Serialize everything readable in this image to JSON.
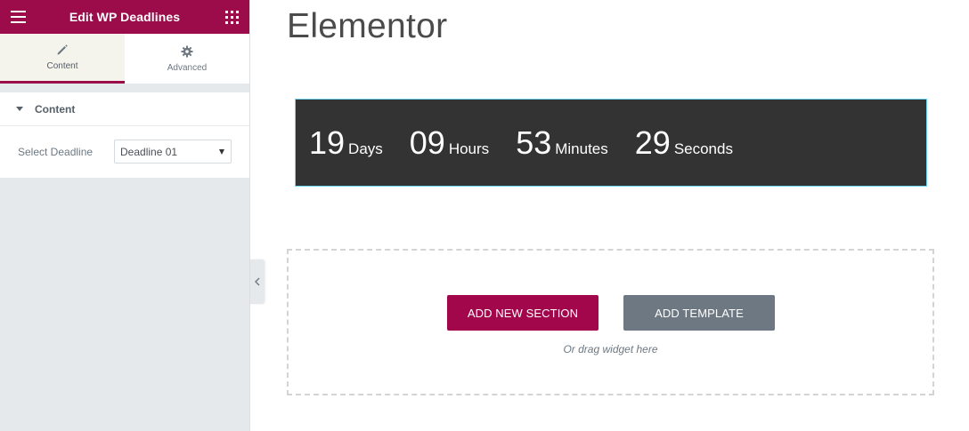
{
  "sidebar": {
    "header_title": "Edit WP Deadlines",
    "menu_icon": "hamburger-menu-icon",
    "widgets_icon": "grid-icon",
    "tabs": [
      {
        "label": "Content",
        "icon": "pencil-icon",
        "active": true
      },
      {
        "label": "Advanced",
        "icon": "gear-icon",
        "active": false
      }
    ],
    "section": {
      "title": "Content",
      "control_label": "Select Deadline",
      "select_value": "Deadline 01"
    }
  },
  "canvas": {
    "page_title": "Elementor",
    "countdown": [
      {
        "value": "19",
        "unit": "Days"
      },
      {
        "value": "09",
        "unit": "Hours"
      },
      {
        "value": "53",
        "unit": "Minutes"
      },
      {
        "value": "29",
        "unit": "Seconds"
      }
    ],
    "add_section_label": "ADD NEW SECTION",
    "add_template_label": "ADD TEMPLATE",
    "drag_hint": "Or drag widget here"
  },
  "colors": {
    "brand": "#9c0c4a",
    "countdown_bg": "#333333",
    "secondary_button": "#6d7882"
  }
}
